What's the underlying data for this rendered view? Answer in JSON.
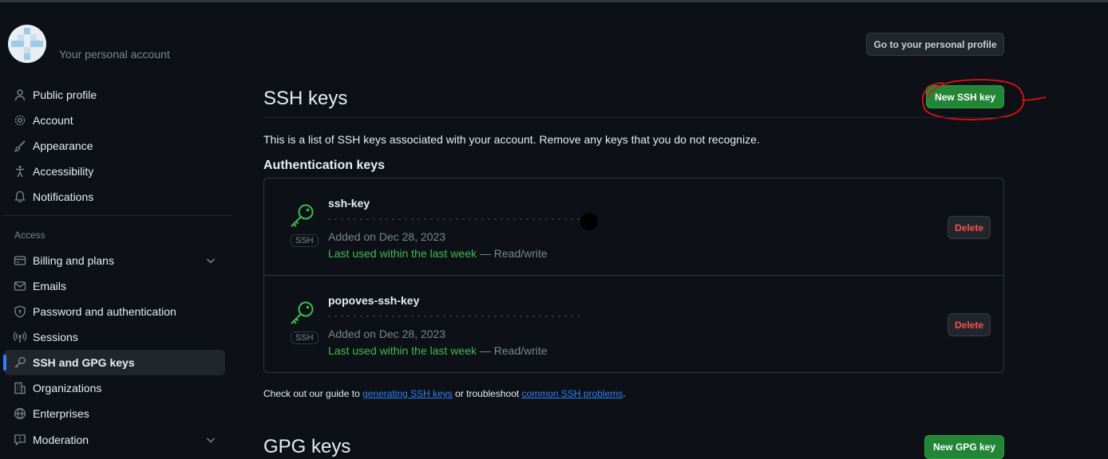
{
  "sidebar": {
    "account_subtitle": "Your personal account",
    "items_top": [
      {
        "label": "Public profile",
        "icon": "person-icon"
      },
      {
        "label": "Account",
        "icon": "gear-icon"
      },
      {
        "label": "Appearance",
        "icon": "paintbrush-icon"
      },
      {
        "label": "Accessibility",
        "icon": "accessibility-icon"
      },
      {
        "label": "Notifications",
        "icon": "bell-icon"
      }
    ],
    "access_heading": "Access",
    "items_access": [
      {
        "label": "Billing and plans",
        "icon": "credit-card-icon",
        "expandable": true
      },
      {
        "label": "Emails",
        "icon": "mail-icon"
      },
      {
        "label": "Password and authentication",
        "icon": "shield-lock-icon"
      },
      {
        "label": "Sessions",
        "icon": "broadcast-icon"
      },
      {
        "label": "SSH and GPG keys",
        "icon": "key-icon",
        "active": true
      },
      {
        "label": "Organizations",
        "icon": "organization-icon"
      },
      {
        "label": "Enterprises",
        "icon": "globe-icon"
      },
      {
        "label": "Moderation",
        "icon": "report-icon",
        "expandable": true
      }
    ]
  },
  "header": {
    "profile_button": "Go to your personal profile"
  },
  "ssh": {
    "title": "SSH keys",
    "new_button": "New SSH key",
    "description": "This is a list of SSH keys associated with your account. Remove any keys that you do not recognize.",
    "auth_heading": "Authentication keys",
    "keys": [
      {
        "name": "ssh-key",
        "badge": "SSH",
        "added": "Added on Dec 28, 2023",
        "last_used": "Last used within the last week",
        "access": " — Read/write",
        "delete_label": "Delete"
      },
      {
        "name": "popoves-ssh-key",
        "badge": "SSH",
        "added": "Added on Dec 28, 2023",
        "last_used": "Last used within the last week",
        "access": " — Read/write",
        "delete_label": "Delete"
      }
    ],
    "footer": {
      "pre": "Check out our guide to ",
      "link1": "generating SSH keys",
      "mid": " or troubleshoot ",
      "link2": "common SSH problems",
      "post": "."
    }
  },
  "gpg": {
    "title": "GPG keys",
    "new_button": "New GPG key"
  },
  "colors": {
    "background": "#0d1117",
    "accent_blue": "#2f81f7",
    "green_button": "#238636",
    "success_text": "#3fb950",
    "danger_text": "#f85149",
    "annotation_red": "#e01010"
  }
}
